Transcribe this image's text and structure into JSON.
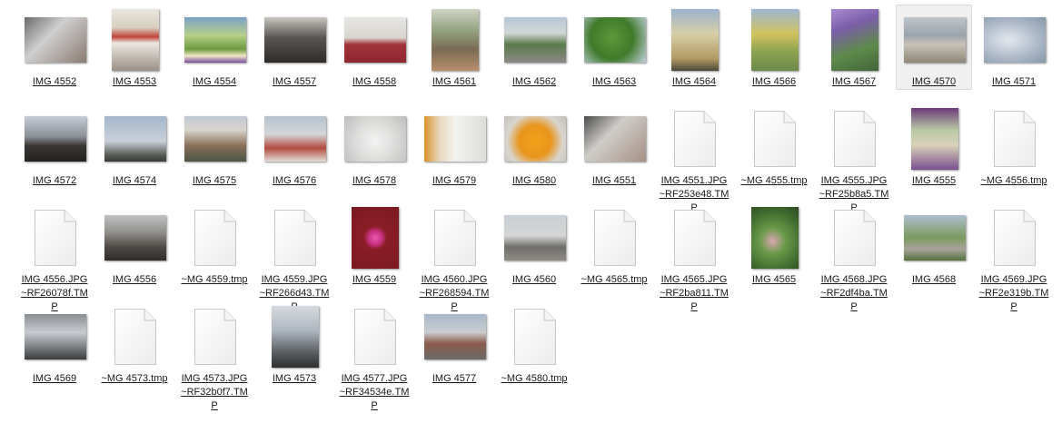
{
  "items": [
    {
      "label": "IMG 4552",
      "type": "photo",
      "bg": "linear-gradient(135deg,#6b6b6b 0%,#cfcfcf 40%,#8a7a72 100%)",
      "w": 68,
      "h": 50
    },
    {
      "label": "IMG 4553",
      "type": "photo",
      "bg": "linear-gradient(180deg,#e9e6de 0%,#d8cfc0 30%,#c0443a 45%,#ebe7e0 55%,#9a8f86 100%)",
      "w": 52,
      "h": 68
    },
    {
      "label": "IMG 4554",
      "type": "photo",
      "bg": "linear-gradient(180deg,#7aa0c8 0%,#b7d08a 40%,#6b9a3e 70%,#efe7c4 85%,#7a4da0 100%)",
      "w": 68,
      "h": 50
    },
    {
      "label": "IMG 4557",
      "type": "photo",
      "bg": "linear-gradient(180deg,#c8c6bf 0%,#595654 45%,#2e2b29 100%)",
      "w": 68,
      "h": 50
    },
    {
      "label": "IMG 4558",
      "type": "photo",
      "bg": "linear-gradient(180deg,#e7e6e4 0%,#d9d6d0 45%,#a2343a 60%,#8e2630 100%)",
      "w": 68,
      "h": 50
    },
    {
      "label": "IMG 4561",
      "type": "photo",
      "bg": "linear-gradient(180deg,#cfd3c4 0%,#93a27f 35%,#7b6b55 65%,#b88e6c 100%)",
      "w": 52,
      "h": 68
    },
    {
      "label": "IMG 4562",
      "type": "photo",
      "bg": "linear-gradient(180deg,#b7c6d5 0%,#d1d6d6 35%,#5a7a4b 60%,#8a8a86 100%)",
      "w": 68,
      "h": 50
    },
    {
      "label": "IMG 4563",
      "type": "photo",
      "bg": "radial-gradient(circle at 45% 45%,#5c9a3c 0%,#3f7a2a 50%,#c3d0df 100%)",
      "w": 68,
      "h": 50
    },
    {
      "label": "IMG 4564",
      "type": "photo",
      "bg": "linear-gradient(180deg,#9cb2cf 0%,#d7cfa7 40%,#b39a63 80%,#4a4a3a 100%)",
      "w": 52,
      "h": 68
    },
    {
      "label": "IMG 4566",
      "type": "photo",
      "bg": "linear-gradient(180deg,#9db6d3 0%,#d1c25e 40%,#8aa14e 70%,#6b8a4a 100%)",
      "w": 52,
      "h": 68
    },
    {
      "label": "IMG 4567",
      "type": "photo",
      "bg": "linear-gradient(160deg,#a88ad0 0%,#7a5ea8 30%,#5e8a4a 65%,#41653a 100%)",
      "w": 52,
      "h": 68
    },
    {
      "label": "IMG 4570",
      "type": "photo",
      "bg": "linear-gradient(180deg,#bfc6cc 0%,#9ba4ab 40%,#c7c2b6 60%,#8e8779 100%)",
      "w": 68,
      "h": 50,
      "selected": true
    },
    {
      "label": "IMG 4571",
      "type": "photo",
      "bg": "radial-gradient(ellipse at 40% 50%,#e4e8ee 0%,#aab6c6 60%,#8796aa 100%)",
      "w": 68,
      "h": 50
    },
    {
      "label": "IMG 4572",
      "type": "photo",
      "bg": "linear-gradient(180deg,#c5ccd5 0%,#8b9097 45%,#3a3836 65%,#24221f 100%)",
      "w": 68,
      "h": 50
    },
    {
      "label": "IMG 4574",
      "type": "photo",
      "bg": "linear-gradient(180deg,#a5b7cc 0%,#c8d0d8 55%,#5a5d58 85%,#393a35 100%)",
      "w": 68,
      "h": 50
    },
    {
      "label": "IMG 4575",
      "type": "photo",
      "bg": "linear-gradient(180deg,#c0c8d2 0%,#d8d4cc 30%,#8a6f5a 65%,#4b5545 100%)",
      "w": 68,
      "h": 50
    },
    {
      "label": "IMG 4576",
      "type": "photo",
      "bg": "linear-gradient(180deg,#b5c1cd 0%,#d4d6d8 40%,#b24b3e 70%,#e1ddd7 100%)",
      "w": 68,
      "h": 50
    },
    {
      "label": "IMG 4578",
      "type": "photo",
      "bg": "radial-gradient(circle at 50% 55%,#f3f3f2 0%,#dcdcdb 50%,#bdbdbc 100%)",
      "w": 68,
      "h": 50
    },
    {
      "label": "IMG 4579",
      "type": "photo",
      "bg": "linear-gradient(90deg,#d8922a 0%,#e7d8c0 25%,#f2f2ef 50%,#dedcd8 100%)",
      "w": 68,
      "h": 50
    },
    {
      "label": "IMG 4580",
      "type": "photo",
      "bg": "radial-gradient(circle at 50% 55%,#f0a21a 0%,#e8951c 40%,#d8d5cf 70%,#c3c0ba 100%)",
      "w": 68,
      "h": 50
    },
    {
      "label": "IMG 4551",
      "type": "photo",
      "bg": "linear-gradient(135deg,#4b4b4b 0%,#cfcdc9 40%,#a58f85 100%)",
      "w": 68,
      "h": 50
    },
    {
      "label": "IMG 4551.JPG~RF253e48.TMP",
      "type": "doc"
    },
    {
      "label": "~MG 4555.tmp",
      "type": "doc"
    },
    {
      "label": "IMG 4555.JPG~RF25b8a5.TMP",
      "type": "doc"
    },
    {
      "label": "IMG 4555",
      "type": "photo",
      "bg": "linear-gradient(180deg,#6d3a7a 0%,#b8c7a5 35%,#d9d2b9 60%,#7a4f8e 100%)",
      "w": 52,
      "h": 68
    },
    {
      "label": "~MG 4556.tmp",
      "type": "doc"
    },
    {
      "label": "IMG 4556.JPG~RF26078f.TMP",
      "type": "doc"
    },
    {
      "label": "IMG 4556",
      "type": "photo",
      "bg": "linear-gradient(180deg,#bfc1c3 0%,#8e8c88 40%,#4f4a46 70%,#2f2c2a 100%)",
      "w": 68,
      "h": 50
    },
    {
      "label": "~MG 4559.tmp",
      "type": "doc"
    },
    {
      "label": "IMG 4559.JPG~RF266d43.TMP",
      "type": "doc"
    },
    {
      "label": "IMG 4559",
      "type": "photo",
      "bg": "radial-gradient(circle at 50% 50%,#e95ab0 0%,#c7307e 18%,#8a1d26 30%,#7a1a22 100%)",
      "w": 52,
      "h": 68
    },
    {
      "label": "IMG 4560.JPG~RF268594.TMP",
      "type": "doc"
    },
    {
      "label": "IMG 4560",
      "type": "photo",
      "bg": "linear-gradient(180deg,#c9cfd6 0%,#d5d6d4 45%,#6f6e6a 70%,#8f8c86 100%)",
      "w": 68,
      "h": 50
    },
    {
      "label": "~MG 4565.tmp",
      "type": "doc"
    },
    {
      "label": "IMG 4565.JPG~RF2ba811.TMP",
      "type": "doc"
    },
    {
      "label": "IMG 4565",
      "type": "photo",
      "bg": "radial-gradient(circle at 45% 55%,#d9a6b0 0%,#6a9a4a 30%,#3f6a2e 70%,#2e4a22 100%)",
      "w": 52,
      "h": 68
    },
    {
      "label": "IMG 4568.JPG~RF2df4ba.TMP",
      "type": "doc"
    },
    {
      "label": "IMG 4568",
      "type": "photo",
      "bg": "linear-gradient(180deg,#aebfcf 0%,#7a9a5e 50%,#a8a29a 75%,#55733d 100%)",
      "w": 68,
      "h": 50
    },
    {
      "label": "IMG 4569.JPG~RF2e319b.TMP",
      "type": "doc"
    },
    {
      "label": "IMG 4569",
      "type": "photo",
      "bg": "linear-gradient(180deg,#8a8e94 0%,#c8ccd0 40%,#9a9ea2 60%,#3a3c3e 100%)",
      "w": 68,
      "h": 50
    },
    {
      "label": "~MG 4573.tmp",
      "type": "doc"
    },
    {
      "label": "IMG 4573.JPG~RF32b0f7.TMP",
      "type": "doc"
    },
    {
      "label": "IMG 4573",
      "type": "photo",
      "bg": "linear-gradient(180deg,#d6dadf 0%,#aeb6bf 40%,#5b5f62 75%,#2d2f30 100%)",
      "w": 52,
      "h": 68
    },
    {
      "label": "IMG 4577.JPG~RF34534e.TMP",
      "type": "doc"
    },
    {
      "label": "IMG 4577",
      "type": "photo",
      "bg": "linear-gradient(180deg,#a8b7c8 0%,#c9cdd0 40%,#8a5a4a 65%,#6b6b6b 100%)",
      "w": 68,
      "h": 50
    },
    {
      "label": "~MG 4580.tmp",
      "type": "doc"
    }
  ]
}
